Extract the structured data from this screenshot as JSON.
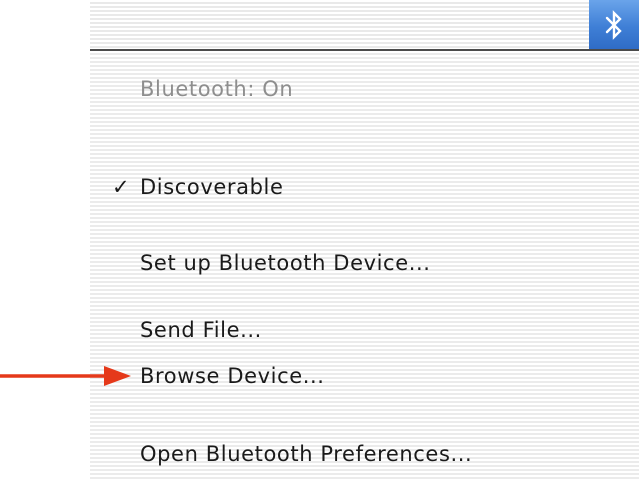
{
  "menubar": {
    "bluetooth_icon": "bluetooth-icon",
    "highlight_color": "#3f7fd6"
  },
  "menu": {
    "status": "Bluetooth: On",
    "discoverable": {
      "label": "Discoverable",
      "checked": true,
      "check_glyph": "✓"
    },
    "setup_device": "Set up Bluetooth Device...",
    "send_file": "Send File...",
    "browse_device": "Browse Device...",
    "open_preferences": "Open Bluetooth Preferences..."
  },
  "annotation": {
    "arrow_color": "#e5391a",
    "points_to": "browse_device"
  }
}
